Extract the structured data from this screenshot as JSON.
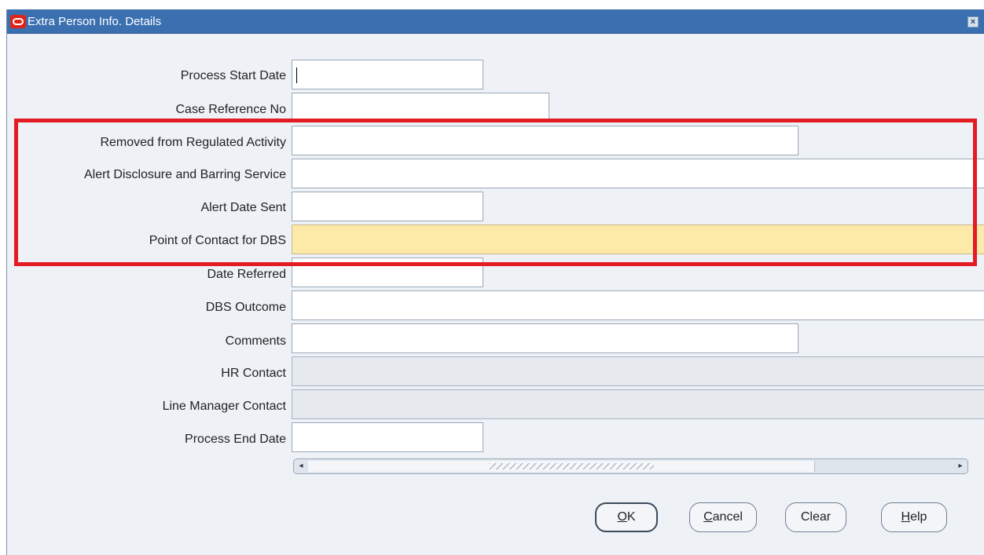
{
  "window": {
    "title": "Extra Person Info. Details",
    "close_glyph": "×"
  },
  "fields": [
    {
      "label": "Process Start Date",
      "value": ""
    },
    {
      "label": "Case Reference No",
      "value": ""
    },
    {
      "label": "Removed from Regulated Activity",
      "value": ""
    },
    {
      "label": "Alert Disclosure and Barring Service",
      "value": ""
    },
    {
      "label": "Alert Date Sent",
      "value": ""
    },
    {
      "label": "Point of Contact for DBS",
      "value": ""
    },
    {
      "label": "Date Referred",
      "value": ""
    },
    {
      "label": "DBS Outcome",
      "value": ""
    },
    {
      "label": "Comments",
      "value": ""
    },
    {
      "label": "HR Contact",
      "value": ""
    },
    {
      "label": "Line Manager Contact",
      "value": ""
    },
    {
      "label": "Process End Date",
      "value": ""
    }
  ],
  "scrollbar": {
    "left_arrow": "◂",
    "right_arrow": "▸"
  },
  "buttons": {
    "ok": {
      "mnemonic": "O",
      "rest": "K"
    },
    "cancel": {
      "mnemonic": "C",
      "rest": "ancel"
    },
    "clear": {
      "mnemonic": "",
      "rest": "Clear"
    },
    "help": {
      "mnemonic": "H",
      "rest": "elp"
    }
  },
  "colors": {
    "titlebar": "#3a6fb0",
    "highlight_border": "#e31b23",
    "required_field": "#fde9a8",
    "readonly_field": "#e6e9ee"
  },
  "icons": {
    "app_logo": "oracle-logo-icon",
    "close": "close-icon"
  }
}
